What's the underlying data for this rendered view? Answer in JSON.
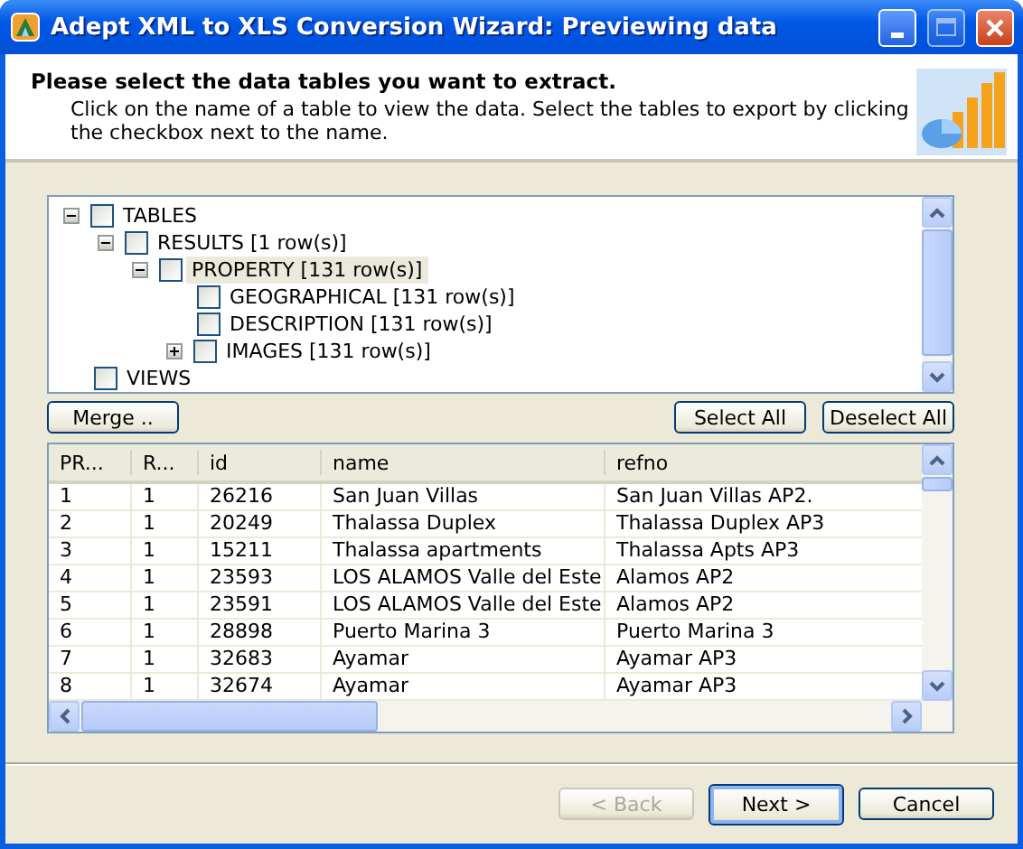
{
  "window": {
    "title": "Adept XML to XLS Conversion Wizard: Previewing data"
  },
  "header": {
    "heading": "Please select the data tables you want to extract.",
    "description": "Click on the name of a table to view the data. Select the tables to export by clicking the checkbox next to the name."
  },
  "tree": [
    {
      "label": "TABLES",
      "checked": false,
      "selected": false,
      "expanded": true,
      "children": [
        {
          "label": "RESULTS [1 row(s)]",
          "checked": false,
          "selected": false,
          "expanded": true,
          "children": [
            {
              "label": "PROPERTY [131 row(s)]",
              "checked": false,
              "selected": true,
              "expanded": true,
              "children": [
                {
                  "label": "GEOGRAPHICAL [131 row(s)]",
                  "checked": false,
                  "selected": false
                },
                {
                  "label": "DESCRIPTION [131 row(s)]",
                  "checked": false,
                  "selected": false
                },
                {
                  "label": "IMAGES [131 row(s)]",
                  "checked": false,
                  "selected": false,
                  "expanded": false
                }
              ]
            }
          ]
        }
      ]
    },
    {
      "label": "VIEWS",
      "checked": false,
      "selected": false
    }
  ],
  "tree_buttons": {
    "merge": "Merge ..",
    "select_all": "Select All",
    "deselect_all": "Deselect All"
  },
  "table": {
    "columns": [
      "PR...",
      "R...",
      "id",
      "name",
      "refno"
    ],
    "rows": [
      [
        "1",
        "1",
        "26216",
        "San Juan Villas",
        "San Juan Villas AP2."
      ],
      [
        "2",
        "1",
        "20249",
        "Thalassa Duplex",
        "Thalassa Duplex AP3"
      ],
      [
        "3",
        "1",
        "15211",
        "Thalassa apartments",
        "Thalassa Apts AP3"
      ],
      [
        "4",
        "1",
        "23593",
        "LOS ALAMOS Valle del Este",
        "Alamos AP2"
      ],
      [
        "5",
        "1",
        "23591",
        "LOS ALAMOS Valle del Este",
        "Alamos  AP2"
      ],
      [
        "6",
        "1",
        "28898",
        "Puerto Marina 3",
        "Puerto Marina 3"
      ],
      [
        "7",
        "1",
        "32683",
        "Ayamar",
        "Ayamar AP3"
      ],
      [
        "8",
        "1",
        "32674",
        "Ayamar",
        "Ayamar AP3"
      ]
    ]
  },
  "buttons": [
    {
      "label": "< Back",
      "disabled": true,
      "default": false
    },
    {
      "label": "Next >",
      "disabled": false,
      "default": true
    },
    {
      "label": "Cancel",
      "disabled": false,
      "default": false
    }
  ]
}
